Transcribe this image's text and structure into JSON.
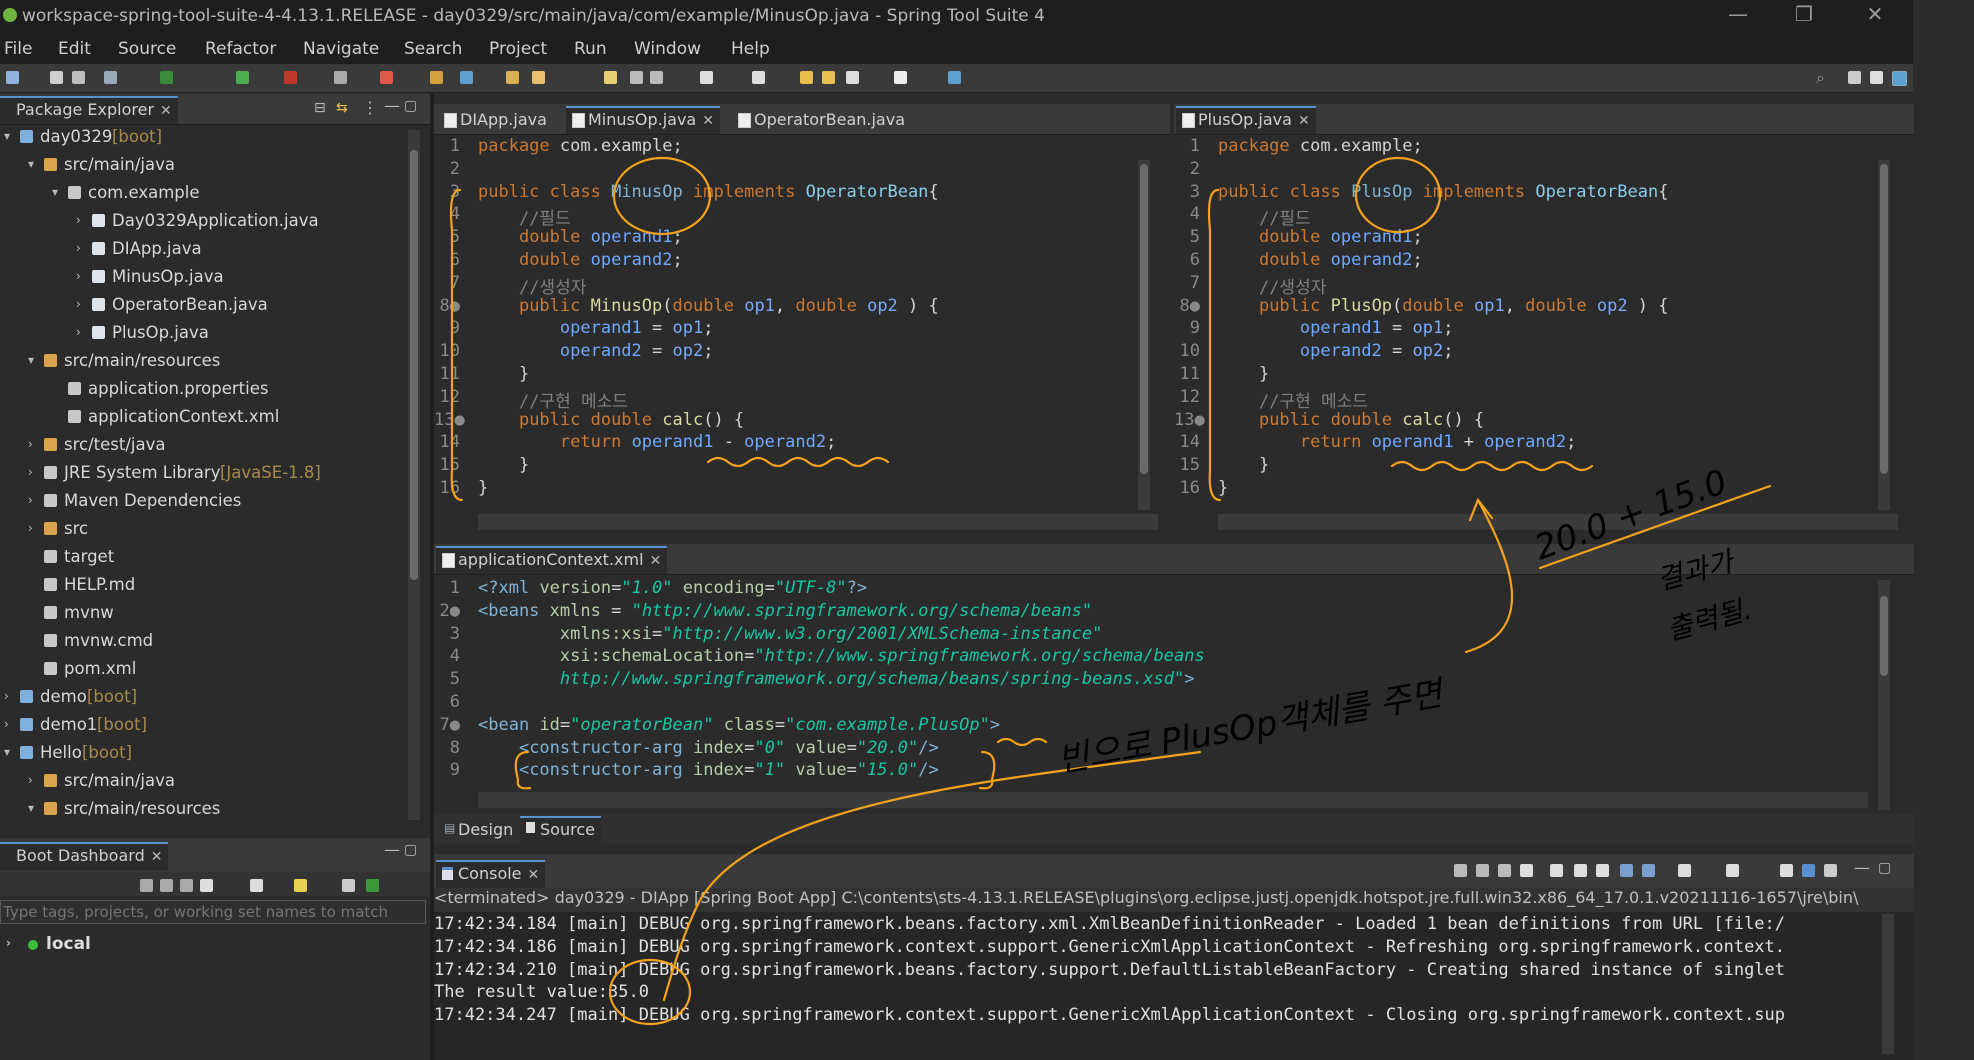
{
  "window": {
    "title": "workspace-spring-tool-suite-4-4.13.1.RELEASE - day0329/src/main/java/com/example/MinusOp.java - Spring Tool Suite 4",
    "minimize": "—",
    "restore": "❐",
    "close": "✕"
  },
  "menu": [
    "File",
    "Edit",
    "Source",
    "Refactor",
    "Navigate",
    "Search",
    "Project",
    "Run",
    "Window",
    "Help"
  ],
  "package_explorer": {
    "title": "Package Explorer",
    "items": [
      {
        "label": "day0329",
        "suffix": " [boot]",
        "indent": 0,
        "exp": "▾"
      },
      {
        "label": "src/main/java",
        "suffix": "",
        "indent": 1,
        "exp": "▾"
      },
      {
        "label": "com.example",
        "suffix": "",
        "indent": 2,
        "exp": "▾"
      },
      {
        "label": "Day0329Application.java",
        "suffix": "",
        "indent": 3,
        "exp": "›"
      },
      {
        "label": "DIApp.java",
        "suffix": "",
        "indent": 3,
        "exp": "›"
      },
      {
        "label": "MinusOp.java",
        "suffix": "",
        "indent": 3,
        "exp": "›"
      },
      {
        "label": "OperatorBean.java",
        "suffix": "",
        "indent": 3,
        "exp": "›"
      },
      {
        "label": "PlusOp.java",
        "suffix": "",
        "indent": 3,
        "exp": "›"
      },
      {
        "label": "src/main/resources",
        "suffix": "",
        "indent": 1,
        "exp": "▾"
      },
      {
        "label": "application.properties",
        "suffix": "",
        "indent": 2,
        "exp": ""
      },
      {
        "label": "applicationContext.xml",
        "suffix": "",
        "indent": 2,
        "exp": ""
      },
      {
        "label": "src/test/java",
        "suffix": "",
        "indent": 1,
        "exp": "›"
      },
      {
        "label": "JRE System Library",
        "suffix": " [JavaSE-1.8]",
        "indent": 1,
        "exp": "›"
      },
      {
        "label": "Maven Dependencies",
        "suffix": "",
        "indent": 1,
        "exp": "›"
      },
      {
        "label": "src",
        "suffix": "",
        "indent": 1,
        "exp": "›"
      },
      {
        "label": "target",
        "suffix": "",
        "indent": 1,
        "exp": ""
      },
      {
        "label": "HELP.md",
        "suffix": "",
        "indent": 1,
        "exp": ""
      },
      {
        "label": "mvnw",
        "suffix": "",
        "indent": 1,
        "exp": ""
      },
      {
        "label": "mvnw.cmd",
        "suffix": "",
        "indent": 1,
        "exp": ""
      },
      {
        "label": "pom.xml",
        "suffix": "",
        "indent": 1,
        "exp": ""
      },
      {
        "label": "demo",
        "suffix": " [boot]",
        "indent": 0,
        "exp": "›"
      },
      {
        "label": "demo1",
        "suffix": " [boot]",
        "indent": 0,
        "exp": "›"
      },
      {
        "label": "Hello",
        "suffix": " [boot]",
        "indent": 0,
        "exp": "▾"
      },
      {
        "label": "src/main/java",
        "suffix": "",
        "indent": 1,
        "exp": "›"
      },
      {
        "label": "src/main/resources",
        "suffix": "",
        "indent": 1,
        "exp": "▾"
      }
    ]
  },
  "boot_dashboard": {
    "title": "Boot Dashboard",
    "filter_placeholder": "Type tags, projects, or working set names to match",
    "local": "local"
  },
  "editor_left": {
    "tabs": [
      {
        "label": "DIApp.java",
        "active": false
      },
      {
        "label": "MinusOp.java",
        "active": true
      },
      {
        "label": "OperatorBean.java",
        "active": false
      }
    ],
    "lines": [
      {
        "n": "1",
        "html": "<span class='kw'>package</span> com.example;"
      },
      {
        "n": "2",
        "html": ""
      },
      {
        "n": "3",
        "html": "<span class='kw'>public class</span> <span class='cls'>MinusOp</span> <span class='kw'>implements</span> <span class='typ'>OperatorBean</span>{"
      },
      {
        "n": "4",
        "html": "    <span class='cmt'>//필드</span>"
      },
      {
        "n": "5",
        "html": "    <span class='kw'>double</span> <span class='fld'>operand1</span>;"
      },
      {
        "n": "6",
        "html": "    <span class='kw'>double</span> <span class='fld'>operand2</span>;"
      },
      {
        "n": "7",
        "html": "    <span class='cmt'>//생성자</span>"
      },
      {
        "n": "8●",
        "html": "    <span class='kw'>public</span> <span class='mth'>MinusOp</span>(<span class='kw'>double</span> <span class='par'>op1</span>, <span class='kw'>double</span> <span class='par'>op2</span> ) {"
      },
      {
        "n": "9",
        "html": "        <span class='fld'>operand1</span> = <span class='par'>op1</span>;"
      },
      {
        "n": "10",
        "html": "        <span class='fld'>operand2</span> = <span class='par'>op2</span>;"
      },
      {
        "n": "11",
        "html": "    }"
      },
      {
        "n": "12",
        "html": "    <span class='cmt'>//구현 메소드</span>"
      },
      {
        "n": "13●",
        "html": "    <span class='kw'>public double</span> <span class='mth'>calc</span>() {"
      },
      {
        "n": "14",
        "html": "        <span class='kw'>return</span> <span class='fld'>operand1</span> - <span class='fld'>operand2</span>;"
      },
      {
        "n": "15",
        "html": "    }"
      },
      {
        "n": "16",
        "html": "}"
      }
    ]
  },
  "editor_right": {
    "tabs": [
      {
        "label": "PlusOp.java",
        "active": true
      }
    ],
    "lines": [
      {
        "n": "1",
        "html": "<span class='kw'>package</span> com.example;"
      },
      {
        "n": "2",
        "html": ""
      },
      {
        "n": "3",
        "html": "<span class='kw'>public class</span> <span class='cls'>PlusOp</span> <span class='kw'>implements</span> <span class='typ'>OperatorBean</span>{"
      },
      {
        "n": "4",
        "html": "    <span class='cmt'>//필드</span>"
      },
      {
        "n": "5",
        "html": "    <span class='kw'>double</span> <span class='fld'>operand1</span>;"
      },
      {
        "n": "6",
        "html": "    <span class='kw'>double</span> <span class='fld'>operand2</span>;"
      },
      {
        "n": "7",
        "html": "    <span class='cmt'>//생성자</span>"
      },
      {
        "n": "8●",
        "html": "    <span class='kw'>public</span> <span class='mth'>PlusOp</span>(<span class='kw'>double</span> <span class='par'>op1</span>, <span class='kw'>double</span> <span class='par'>op2</span> ) {"
      },
      {
        "n": "9",
        "html": "        <span class='fld'>operand1</span> = <span class='par'>op1</span>;"
      },
      {
        "n": "10",
        "html": "        <span class='fld'>operand2</span> = <span class='par'>op2</span>;"
      },
      {
        "n": "11",
        "html": "    }"
      },
      {
        "n": "12",
        "html": "    <span class='cmt'>//구현 메소드</span>"
      },
      {
        "n": "13●",
        "html": "    <span class='kw'>public double</span> <span class='mth'>calc</span>() {"
      },
      {
        "n": "14",
        "html": "        <span class='kw'>return</span> <span class='fld'>operand1</span> + <span class='fld'>operand2</span>;"
      },
      {
        "n": "15",
        "html": "    }"
      },
      {
        "n": "16",
        "html": "}"
      }
    ]
  },
  "xml_editor": {
    "tab": "applicationContext.xml",
    "lines": [
      {
        "n": "1",
        "html": "<span class='tag'>&lt;?xml</span> <span class='attr'>version</span>=<span class='str'>\"1.0\"</span> <span class='attr'>encoding</span>=<span class='str'>\"UTF-8\"</span><span class='tag'>?&gt;</span>"
      },
      {
        "n": "2●",
        "html": "<span class='tag'>&lt;beans</span> <span class='attr'>xmlns</span> = <span class='str'>\"http://www.springframework.org/schema/beans\"</span>"
      },
      {
        "n": "3",
        "html": "        <span class='attr'>xmlns:xsi</span>=<span class='str'>\"http://www.w3.org/2001/XMLSchema-instance\"</span>"
      },
      {
        "n": "4",
        "html": "        <span class='attr'>xsi:schemaLocation</span>=<span class='str'>\"http://www.springframework.org/schema/beans</span>"
      },
      {
        "n": "5",
        "html": "        <span class='str'>http://www.springframework.org/schema/beans/spring-beans.xsd\"</span><span class='tag'>&gt;</span>"
      },
      {
        "n": "6",
        "html": ""
      },
      {
        "n": "7●",
        "html": "<span class='tag'>&lt;bean</span> <span class='attr'>id</span>=<span class='str'>\"operatorBean\"</span> <span class='attr'>class</span>=<span class='str'>\"com.example.PlusOp\"</span><span class='tag'>&gt;</span>"
      },
      {
        "n": "8",
        "html": "    <span class='tag'>&lt;constructor-arg</span> <span class='attr'>index</span>=<span class='str'>\"0\"</span> <span class='attr'>value</span>=<span class='str'>\"20.0\"</span><span class='tag'>/&gt;</span>"
      },
      {
        "n": "9",
        "html": "    <span class='tag'>&lt;constructor-arg</span> <span class='attr'>index</span>=<span class='str'>\"1\"</span> <span class='attr'>value</span>=<span class='str'>\"15.0\"</span><span class='tag'>/&gt;</span>"
      }
    ],
    "design_tab": "Design",
    "source_tab": "Source"
  },
  "console": {
    "title": "Console",
    "terminated": "<terminated> day0329 - DIApp [Spring Boot App] C:\\contents\\sts-4.13.1.RELEASE\\plugins\\org.eclipse.justj.openjdk.hotspot.jre.full.win32.x86_64_17.0.1.v20211116-1657\\jre\\bin\\",
    "lines": [
      "17:42:34.184 [main] DEBUG org.springframework.beans.factory.xml.XmlBeanDefinitionReader - Loaded 1 bean definitions from URL [file:/",
      "17:42:34.186 [main] DEBUG org.springframework.context.support.GenericXmlApplicationContext - Refreshing org.springframework.context.",
      "17:42:34.210 [main] DEBUG org.springframework.beans.factory.support.DefaultListableBeanFactory - Creating shared instance of singlet",
      "The result value:35.0",
      "17:42:34.247 [main] DEBUG org.springframework.context.support.GenericXmlApplicationContext - Closing org.springframework.context.sup"
    ]
  },
  "annotations": {
    "bean_note": "빈으로 PlusOp객체를 주면",
    "sum_note": "20.0 + 15.0",
    "result_note_1": "결과가",
    "result_note_2": "출력될."
  },
  "colors": {
    "accent": "#5a8fd1",
    "annotation": "#f3a21d",
    "keyword": "#cc7832",
    "string": "#17c6a3"
  }
}
